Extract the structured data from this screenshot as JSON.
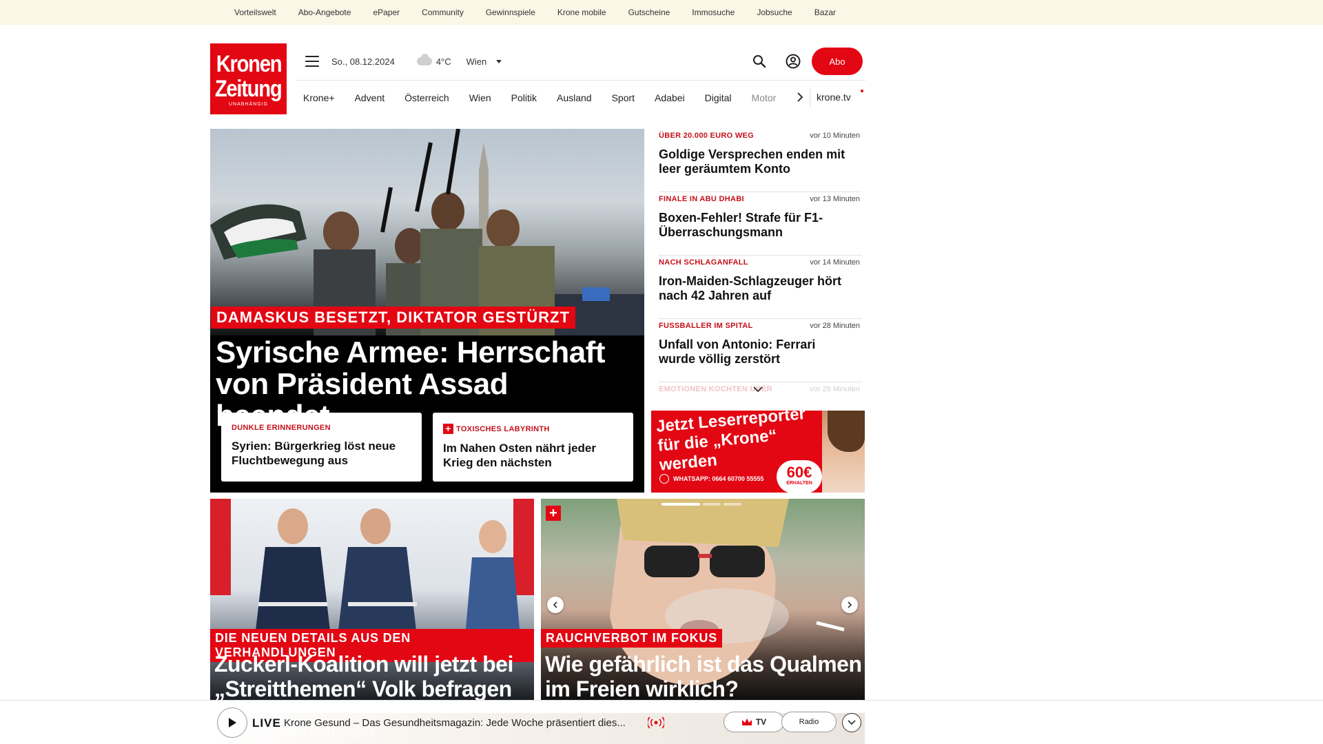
{
  "topbar": {
    "links": [
      "Vorteilswelt",
      "Abo-Angebote",
      "ePaper",
      "Community",
      "Gewinnspiele",
      "Krone mobile",
      "Gutscheine",
      "Immosuche",
      "Jobsuche",
      "Bazar"
    ]
  },
  "logo": {
    "line1": "Kronen",
    "line2": "Zeitung",
    "tagline": "UNABHÄNGIG"
  },
  "header": {
    "date": "So., 08.12.2024",
    "weather_icon": "cloud-icon",
    "temperature": "4°C",
    "city": "Wien",
    "abo_label": "Abo"
  },
  "nav": {
    "items": [
      "Krone+",
      "Advent",
      "Österreich",
      "Wien",
      "Politik",
      "Ausland",
      "Sport",
      "Adabei",
      "Digital",
      "Motor"
    ],
    "tv_link": "krone.tv"
  },
  "hero": {
    "kicker": "DAMASKUS BESETZT, DIKTATOR GESTÜRZT",
    "title": "Syrische Armee: Herrschaft von Präsident Assad beendet",
    "subcards": [
      {
        "kicker": "DUNKLE ERINNERUNGEN",
        "title": "Syrien: Bürgerkrieg löst neue Fluchtbewegung aus",
        "plus": false
      },
      {
        "kicker": "TOXISCHES LABYRINTH",
        "title": "Im Nahen Osten nährt jeder Krieg den nächsten",
        "plus": true
      }
    ]
  },
  "latest": [
    {
      "kicker": "ÜBER 20.000 EURO WEG",
      "time": "vor 10 Minuten",
      "title": "Goldige Versprechen enden mit leer geräumtem Konto"
    },
    {
      "kicker": "FINALE IN ABU DHABI",
      "time": "vor 13 Minuten",
      "title": "Boxen-Fehler! Strafe für F1-Überraschungsmann"
    },
    {
      "kicker": "NACH SCHLAGANFALL",
      "time": "vor 14 Minuten",
      "title": "Iron-Maiden-Schlagzeuger hört nach 42 Jahren auf"
    },
    {
      "kicker": "FUSSBALLER IM SPITAL",
      "time": "vor 28 Minuten",
      "title": "Unfall von Antonio: Ferrari wurde völlig zerstört"
    },
    {
      "kicker": "EMOTIONEN KOCHTEN ÜBER",
      "time": "vor 29 Minuten",
      "title": ""
    }
  ],
  "ad": {
    "headline": "Jetzt Leserreporter für die „Krone“ werden",
    "whatsapp": "WHATSAPP: 0664 60700 55555",
    "amount": "60€",
    "amount_sub": "ERHALTEN"
  },
  "teasers": [
    {
      "kicker": "DIE NEUEN DETAILS AUS DEN VERHANDLUNGEN",
      "title": "Zuckerl-Koalition will jetzt bei „Streitthemen“ Volk befragen"
    },
    {
      "kicker": "RAUCHVERBOT IM FOKUS",
      "title": "Wie gefährlich ist das Qualmen im Freien wirklich?"
    }
  ],
  "player": {
    "live_label": "LIVE",
    "now_playing": "Krone Gesund – Das Gesundheitsmagazin: Jede Woche präsentiert dies...",
    "tv_label": "TV",
    "radio_label": "Radio",
    "behind_text": "Adventkalender"
  },
  "colors": {
    "brand_red": "#e30613",
    "kicker_red": "#c4101a",
    "topbar_bg": "#fbf6e6"
  }
}
